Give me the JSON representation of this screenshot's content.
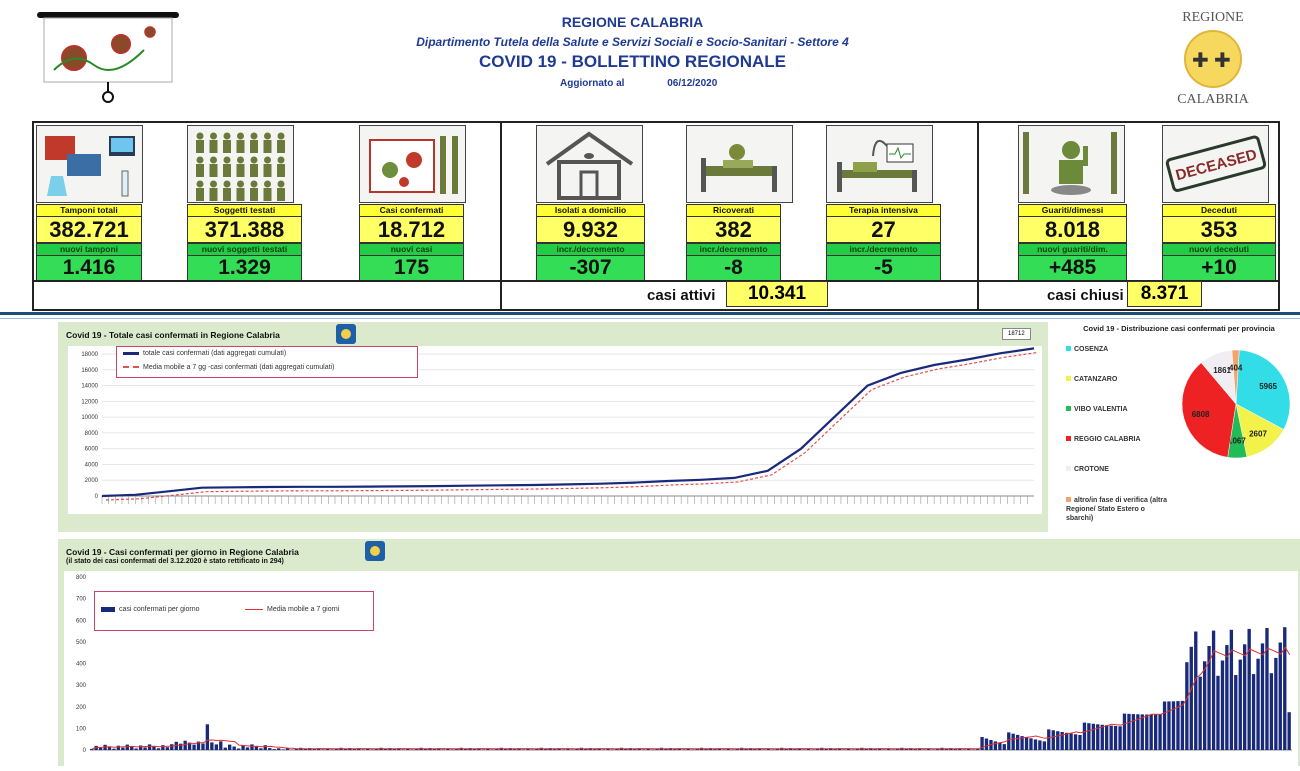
{
  "header": {
    "title": "REGIONE CALABRIA",
    "department": "Dipartimento Tutela della Salute e Servizi Sociali e Socio-Sanitari - Settore 4",
    "bulletin": "COVID 19 - BOLLETTINO REGIONALE",
    "updated_label": "Aggiornato al",
    "updated_date": "06/12/2020",
    "logo_top": "REGIONE",
    "logo_bottom": "CALABRIA"
  },
  "stats": [
    {
      "label": "Tamponi totali",
      "value": "382.721",
      "sub_label": "nuovi tamponi",
      "sub_value": "1.416",
      "icon": "lab-test-icon"
    },
    {
      "label": "Soggetti testati",
      "value": "371.388",
      "sub_label": "nuovi soggetti testati",
      "sub_value": "1.329",
      "icon": "people-grid-icon"
    },
    {
      "label": "Casi confermati",
      "value": "18.712",
      "sub_label": "nuovi casi",
      "sub_value": "175",
      "icon": "virus-person-icon"
    },
    {
      "label": "Isolati a domicilio",
      "value": "9.932",
      "sub_label": "incr./decremento",
      "sub_value": "-307",
      "icon": "house-icon"
    },
    {
      "label": "Ricoverati",
      "value": "382",
      "sub_label": "incr./decremento",
      "sub_value": "-8",
      "icon": "hospital-bed-icon"
    },
    {
      "label": "Terapia intensiva",
      "value": "27",
      "sub_label": "incr./decremento",
      "sub_value": "-5",
      "icon": "icu-bed-icon"
    },
    {
      "label": "Guariti/dimessi",
      "value": "8.018",
      "sub_label": "nuovi guariti/dim.",
      "sub_value": "+485",
      "icon": "recovered-person-icon"
    },
    {
      "label": "Deceduti",
      "value": "353",
      "sub_label": "nuovi deceduti",
      "sub_value": "+10",
      "icon": "deceased-stamp-icon"
    }
  ],
  "active": {
    "label": "casi attivi",
    "value": "10.341"
  },
  "closed": {
    "label": "casi chiusi",
    "value": "8.371"
  },
  "deceased_stamp": "DECEASED",
  "chart_data": [
    {
      "type": "line",
      "title": "Covid 19 - Totale casi confermati in Regione Calabria",
      "series": [
        {
          "name": "totale casi confermati (dati aggregati cumulati)",
          "color": "#1a2a7a"
        },
        {
          "name": "Media mobile a 7 gg -casi confermati (dati aggregati cumulati)",
          "color": "#e05050"
        }
      ],
      "y_ticks": [
        "18000",
        "16000",
        "14000",
        "12000",
        "10000",
        "8000",
        "6000",
        "4000",
        "2000",
        "0"
      ],
      "ylim": [
        0,
        18000
      ],
      "end_label": "18712",
      "x": [
        0,
        10,
        20,
        30,
        40,
        50,
        60,
        70,
        80,
        90,
        100,
        110,
        120,
        130,
        140,
        150,
        160,
        170,
        180,
        190,
        200,
        210,
        220,
        230,
        240,
        250,
        260,
        270,
        280
      ],
      "values": [
        0,
        150,
        600,
        1050,
        1100,
        1140,
        1160,
        1170,
        1190,
        1220,
        1250,
        1300,
        1350,
        1400,
        1470,
        1560,
        1700,
        1900,
        2050,
        2300,
        3200,
        6000,
        10000,
        14000,
        15600,
        16600,
        17300,
        18100,
        18712
      ]
    },
    {
      "type": "bar",
      "title": "Covid 19 - Casi confermati per giorno in Regione Calabria",
      "subtitle": "(il stato dei casi confermati del 3.12.2020 è stato rettificato in 294)",
      "series": [
        {
          "name": "casi confermati per giorno",
          "color": "#1a2a7a"
        },
        {
          "name": "Media mobile a 7 giorni",
          "color": "#e03030"
        }
      ],
      "y_ticks": [
        "800",
        "700",
        "600",
        "500",
        "400",
        "300",
        "200",
        "100",
        "0"
      ],
      "ylim": [
        0,
        800
      ]
    },
    {
      "type": "pie",
      "title": "Covid 19 - Distribuzione casi confermati per provincia",
      "categories": [
        "COSENZA",
        "CATANZARO",
        "VIBO VALENTIA",
        "REGGIO CALABRIA",
        "CROTONE",
        "altro/in fase di verifica (altra Regione/ Stato Estero o sbarchi)"
      ],
      "values": [
        5965,
        2607,
        1067,
        6808,
        1861,
        404
      ],
      "colors": [
        "#33dde8",
        "#f2f24a",
        "#22bb55",
        "#ee2222",
        "#f0eef2",
        "#f4a36a"
      ]
    }
  ]
}
